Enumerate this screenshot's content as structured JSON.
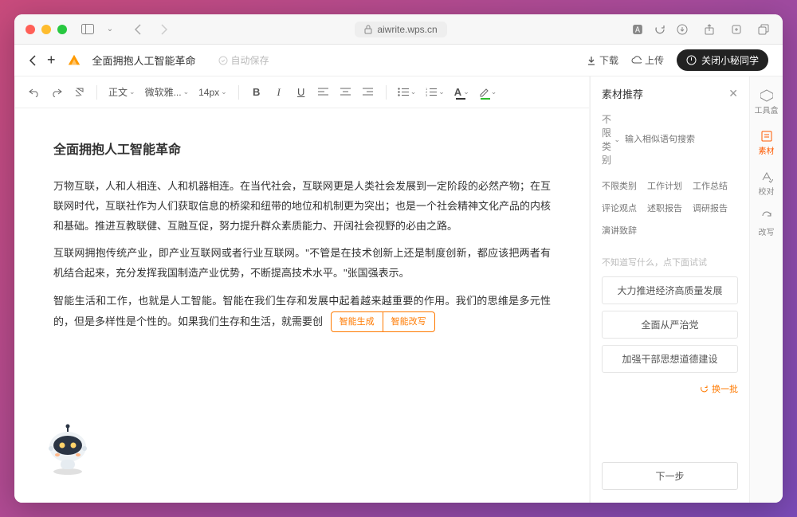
{
  "browser": {
    "url": "aiwrite.wps.cn"
  },
  "appbar": {
    "title": "全面拥抱人工智能革命",
    "autosave": "自动保存",
    "download": "下载",
    "upload": "上传",
    "close_assistant": "关闭小秘同学"
  },
  "toolbar": {
    "font_style": "正文",
    "font_family": "微软雅...",
    "font_size": "14px"
  },
  "document": {
    "heading": "全面拥抱人工智能革命",
    "p1": "万物互联，人和人相连、人和机器相连。在当代社会，互联网更是人类社会发展到一定阶段的必然产物；在互联网时代，互联社作为人们获取信息的桥梁和纽带的地位和机制更为突出；也是一个社会精神文化产品的内核和基础。推进互教联健、互融互促，努力提升群众素质能力、开阔社会视野的必由之路。",
    "p2": "互联网拥抱传统产业，即产业互联网或者行业互联网。\"不管是在技术创新上还是制度创新，都应该把两者有机结合起来，充分发挥我国制造产业优势，不断提高技术水平。\"张国强表示。",
    "p3_prefix": "智能生活和工作，也就是人工智能。智能在我们生存和发展中起着越来越重要的作用。我们的思维是多元性的，但是多样性是个性的。如果我们生存和生活，就需要创",
    "smart_gen": "智能生成",
    "smart_rewrite": "智能改写"
  },
  "side": {
    "title": "素材推荐",
    "cat_selected": "不限类别",
    "search_placeholder": "输入相似语句搜索",
    "cats": [
      "不限类别",
      "工作计划",
      "工作总结",
      "评论观点",
      "述职报告",
      "调研报告",
      "演讲致辞"
    ],
    "hint": "不知道写什么，点下面试试",
    "suggestions": [
      "大力推进经济高质量发展",
      "全面从严治党",
      "加强干部思想道德建设"
    ],
    "refresh": "换一批",
    "next": "下一步"
  },
  "rail": {
    "items": [
      "工具盒",
      "素材",
      "校对",
      "改写"
    ]
  }
}
